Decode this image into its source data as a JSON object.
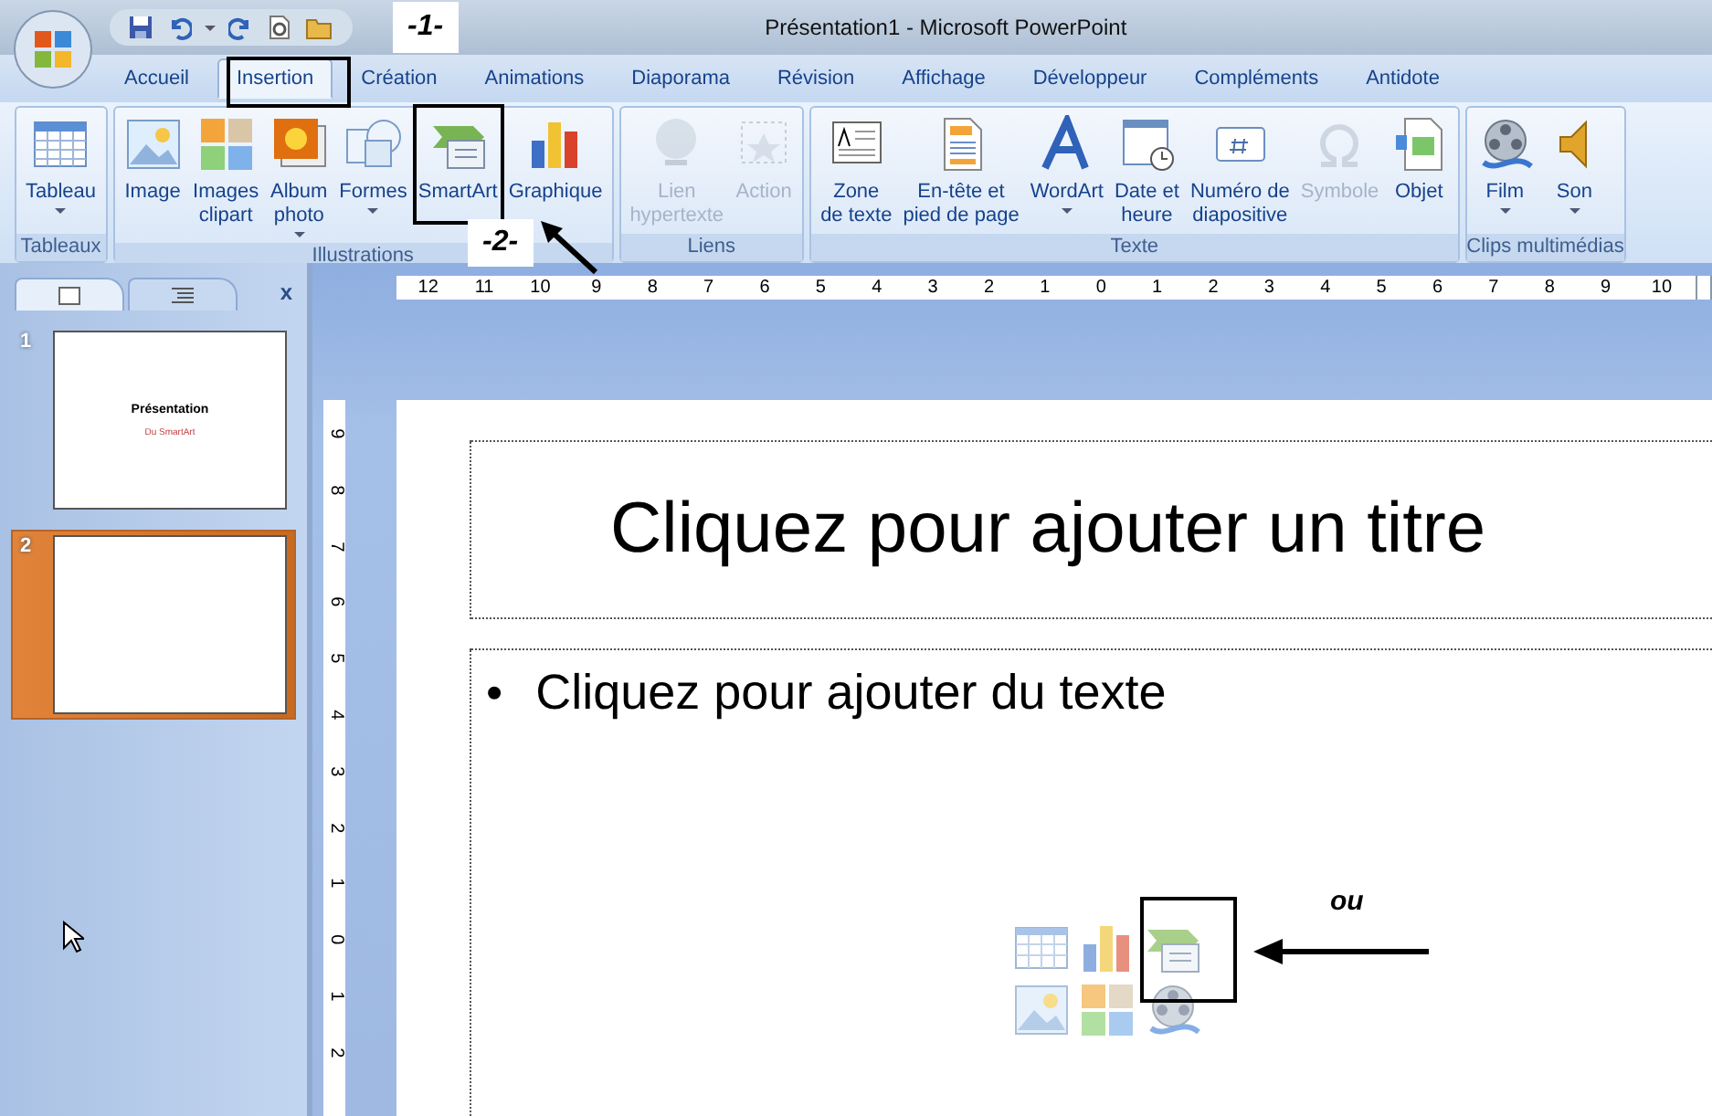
{
  "window": {
    "title": "Présentation1 - Microsoft PowerPoint"
  },
  "annotations": [
    {
      "kind": "label",
      "text": "-1-"
    },
    {
      "kind": "label",
      "text": "-2-"
    },
    {
      "kind": "note",
      "text": "ou"
    }
  ],
  "tabs": [
    {
      "label": "Accueil",
      "selected": false
    },
    {
      "label": "Insertion",
      "selected": true
    },
    {
      "label": "Création",
      "selected": false
    },
    {
      "label": "Animations",
      "selected": false
    },
    {
      "label": "Diaporama",
      "selected": false
    },
    {
      "label": "Révision",
      "selected": false
    },
    {
      "label": "Affichage",
      "selected": false
    },
    {
      "label": "Développeur",
      "selected": false
    },
    {
      "label": "Compléments",
      "selected": false
    },
    {
      "label": "Antidote",
      "selected": false
    }
  ],
  "ribbon_groups": [
    {
      "label": "Tableaux",
      "buttons": [
        {
          "label": "Tableau",
          "dropdown": true,
          "disabled": false
        }
      ]
    },
    {
      "label": "Illustrations",
      "buttons": [
        {
          "label": "Image",
          "dropdown": false,
          "disabled": false
        },
        {
          "label": "Images\nclipart",
          "dropdown": false,
          "disabled": false
        },
        {
          "label": "Album\nphoto",
          "dropdown": true,
          "disabled": false
        },
        {
          "label": "Formes",
          "dropdown": true,
          "disabled": false
        },
        {
          "label": "SmartArt",
          "dropdown": false,
          "disabled": false
        },
        {
          "label": "Graphique",
          "dropdown": false,
          "disabled": false
        }
      ]
    },
    {
      "label": "Liens",
      "buttons": [
        {
          "label": "Lien\nhypertexte",
          "dropdown": false,
          "disabled": true
        },
        {
          "label": "Action",
          "dropdown": false,
          "disabled": true
        }
      ]
    },
    {
      "label": "Texte",
      "buttons": [
        {
          "label": "Zone\nde texte",
          "dropdown": false,
          "disabled": false
        },
        {
          "label": "En-tête et\npied de page",
          "dropdown": false,
          "disabled": false
        },
        {
          "label": "WordArt",
          "dropdown": true,
          "disabled": false
        },
        {
          "label": "Date et\nheure",
          "dropdown": false,
          "disabled": false
        },
        {
          "label": "Numéro de\ndiapositive",
          "dropdown": false,
          "disabled": false
        },
        {
          "label": "Symbole",
          "dropdown": false,
          "disabled": true
        },
        {
          "label": "Objet",
          "dropdown": false,
          "disabled": false
        }
      ]
    },
    {
      "label": "Clips multimédias",
      "buttons": [
        {
          "label": "Film",
          "dropdown": true,
          "disabled": false
        },
        {
          "label": "Son",
          "dropdown": true,
          "disabled": false
        }
      ]
    }
  ],
  "panel": {
    "tabs": [
      {
        "kind": "slides",
        "selected": true
      },
      {
        "kind": "outline",
        "selected": false
      }
    ],
    "close": "x"
  },
  "slides": [
    {
      "number": "1",
      "selected": false,
      "title": "Présentation",
      "subtitle": "Du SmartArt"
    },
    {
      "number": "2",
      "selected": true
    }
  ],
  "rulers": {
    "horizontal": [
      "12",
      "11",
      "10",
      "9",
      "8",
      "7",
      "6",
      "5",
      "4",
      "3",
      "2",
      "1",
      "0",
      "1",
      "2",
      "3",
      "4",
      "5",
      "6",
      "7",
      "8",
      "9",
      "10"
    ],
    "vertical": [
      "9",
      "8",
      "7",
      "6",
      "5",
      "4",
      "3",
      "2",
      "1",
      "0",
      "1",
      "2"
    ]
  },
  "slide": {
    "title_placeholder": "Cliquez pour ajouter un titre",
    "bullet": "•",
    "body_placeholder": "Cliquez pour ajouter du texte",
    "content_icons": [
      {
        "kind": "table"
      },
      {
        "kind": "chart"
      },
      {
        "kind": "smartart"
      },
      {
        "kind": "image"
      },
      {
        "kind": "clipart"
      },
      {
        "kind": "media"
      }
    ]
  }
}
